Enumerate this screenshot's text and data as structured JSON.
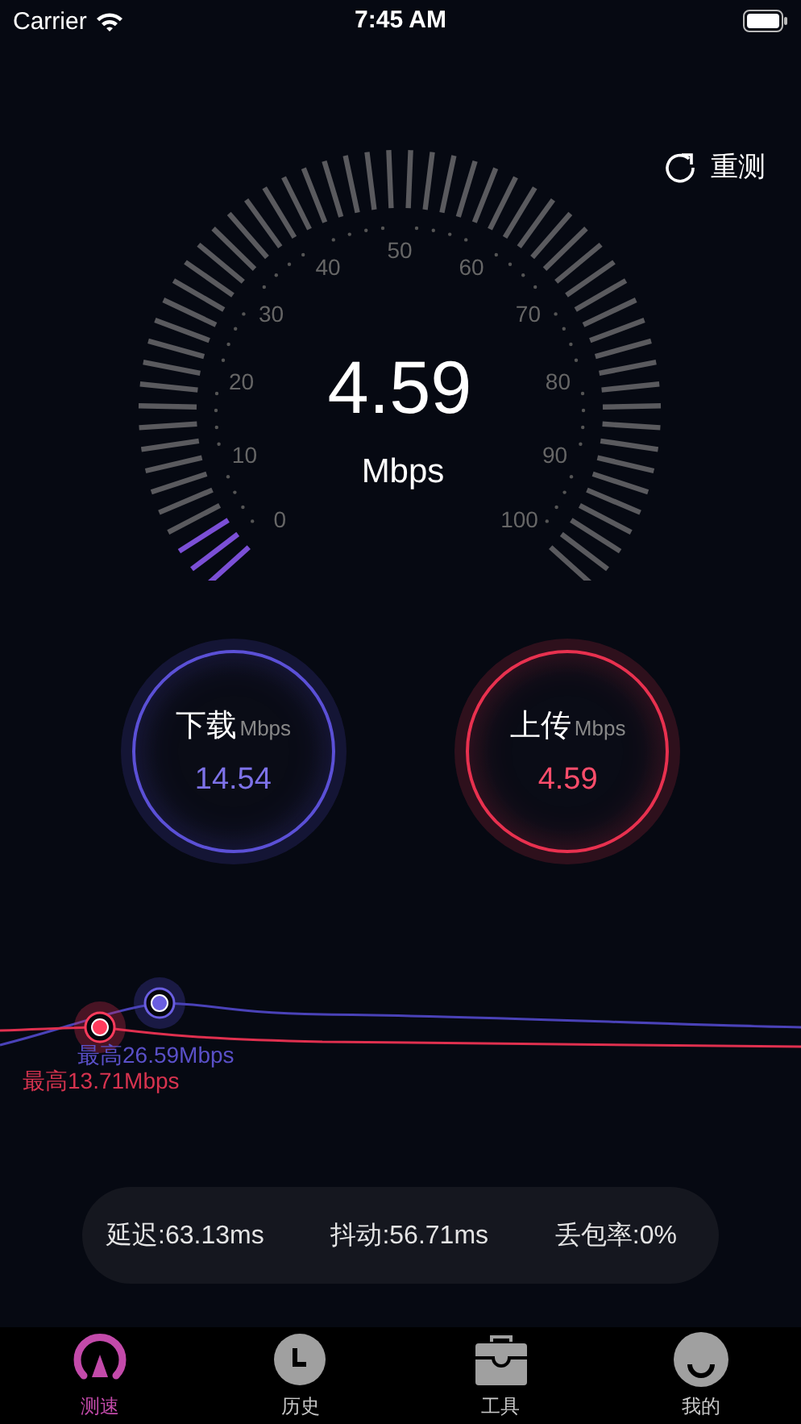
{
  "status_bar": {
    "carrier": "Carrier",
    "time": "7:45 AM"
  },
  "retest_button": "重测",
  "gauge": {
    "scale_labels": [
      "0",
      "10",
      "20",
      "30",
      "40",
      "50",
      "60",
      "70",
      "80",
      "90",
      "100"
    ],
    "value": "4.59",
    "unit": "Mbps"
  },
  "meters": [
    {
      "kind": "download",
      "label": "下载",
      "unit": "Mbps",
      "value": "14.54"
    },
    {
      "kind": "upload",
      "label": "上传",
      "unit": "Mbps",
      "value": "4.59"
    }
  ],
  "chart": {
    "peaks": [
      {
        "kind": "download",
        "text": "最高26.59Mbps"
      },
      {
        "kind": "upload",
        "text": "最高13.71Mbps"
      }
    ]
  },
  "stats": [
    "延迟:63.13ms",
    "抖动:56.71ms",
    "丢包率:0%"
  ],
  "tabs": [
    {
      "kind": "gauge",
      "label": "测速",
      "selected": true
    },
    {
      "kind": "clock",
      "label": "历史",
      "selected": false
    },
    {
      "kind": "toolbox",
      "label": "工具",
      "selected": false
    },
    {
      "kind": "face",
      "label": "我的",
      "selected": false
    }
  ]
}
